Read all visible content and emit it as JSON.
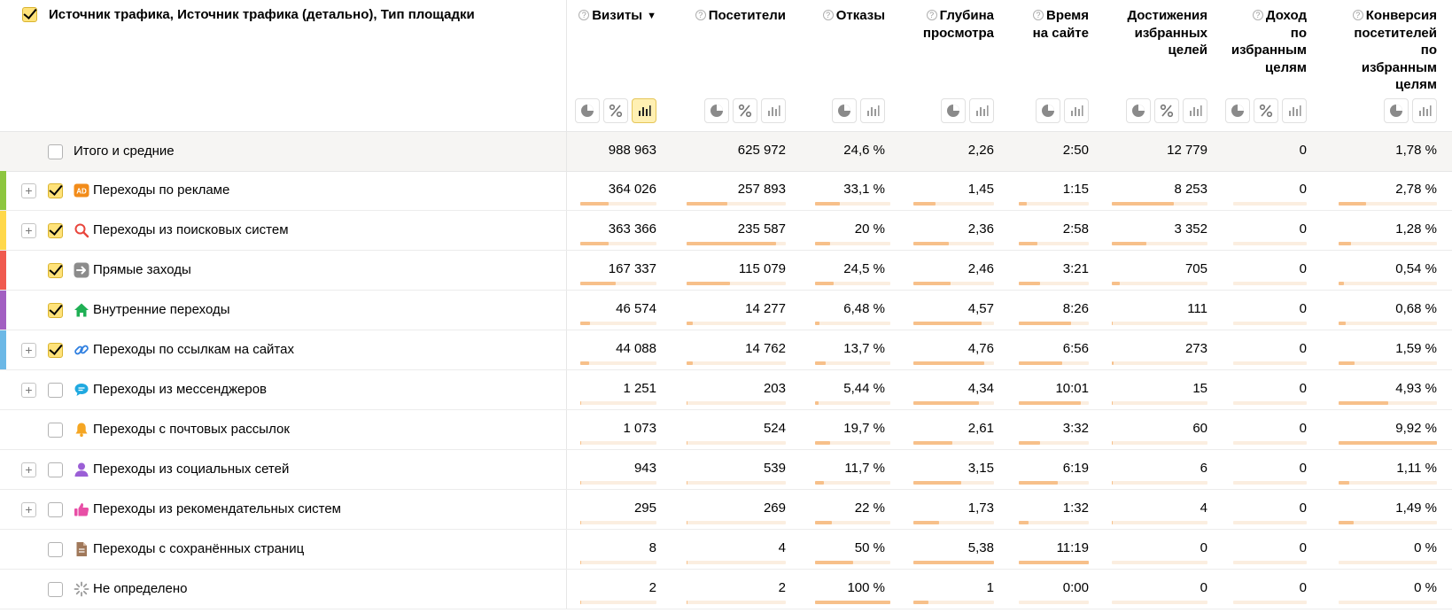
{
  "header": {
    "dimension_title": "Источник трафика, Источник трафика (детально), Тип площадки",
    "help_mark": "?",
    "sort_mark": "▼",
    "metrics": [
      {
        "title": "Визиты",
        "help": true,
        "sorted": true,
        "tools": [
          "pie",
          "percent",
          "bars-active"
        ]
      },
      {
        "title": "Посетители",
        "help": true,
        "sorted": false,
        "tools": [
          "pie",
          "percent",
          "bars"
        ]
      },
      {
        "title": "Отказы",
        "help": true,
        "sorted": false,
        "tools": [
          "pie",
          "bars"
        ]
      },
      {
        "title": "Глубина\nпросмотра",
        "help": true,
        "sorted": false,
        "tools": [
          "pie",
          "bars"
        ]
      },
      {
        "title": "Время\nна сайте",
        "help": true,
        "sorted": false,
        "tools": [
          "pie",
          "bars"
        ]
      },
      {
        "title": "Достижения\nизбранных\nцелей",
        "help": false,
        "sorted": false,
        "tools": [
          "pie",
          "percent",
          "bars"
        ]
      },
      {
        "title": "Доход\nпо\nизбранным\nцелям",
        "help": true,
        "sorted": false,
        "tools": [
          "pie",
          "percent",
          "bars"
        ]
      },
      {
        "title": "Конверсия\nпосетителей\nпо\nизбранным\nцелям",
        "help": true,
        "sorted": false,
        "tools": [
          "pie",
          "bars"
        ]
      }
    ]
  },
  "totals": {
    "label": "Итого и средние",
    "values": [
      "988 963",
      "625 972",
      "24,6 %",
      "2,26",
      "2:50",
      "12 779",
      "0",
      "1,78 %"
    ]
  },
  "rows": [
    {
      "label": "Переходы по рекламе",
      "icon": "ad-icon",
      "icon_text": "AD",
      "color": "#8dc63f",
      "expandable": true,
      "checked": true,
      "values": [
        "364 026",
        "257 893",
        "33,1 %",
        "1,45",
        "1:15",
        "8 253",
        "0",
        "2,78 %"
      ],
      "fills": [
        0.37,
        0.41,
        0.33,
        0.27,
        0.11,
        0.65,
        0,
        0.28
      ]
    },
    {
      "label": "Переходы из поисковых систем",
      "icon": "search-icon",
      "color": "#ffd84a",
      "expandable": true,
      "checked": true,
      "values": [
        "363 366",
        "235 587",
        "20 %",
        "2,36",
        "2:58",
        "3 352",
        "0",
        "1,28 %"
      ],
      "fills": [
        0.37,
        0.9,
        0.2,
        0.44,
        0.26,
        0.36,
        0,
        0.13
      ]
    },
    {
      "label": "Прямые заходы",
      "icon": "arrow-right-icon",
      "color": "#f05a4f",
      "expandable": false,
      "checked": true,
      "values": [
        "167 337",
        "115 079",
        "24,5 %",
        "2,46",
        "3:21",
        "705",
        "0",
        "0,54 %"
      ],
      "fills": [
        0.46,
        0.44,
        0.25,
        0.46,
        0.3,
        0.08,
        0,
        0.05
      ]
    },
    {
      "label": "Внутренние переходы",
      "icon": "home-icon",
      "color": "#a25fc2",
      "expandable": false,
      "checked": true,
      "values": [
        "46 574",
        "14 277",
        "6,48 %",
        "4,57",
        "8:26",
        "111",
        "0",
        "0,68 %"
      ],
      "fills": [
        0.13,
        0.06,
        0.06,
        0.85,
        0.75,
        0.01,
        0,
        0.07
      ]
    },
    {
      "label": "Переходы по ссылкам на сайтах",
      "icon": "link-icon",
      "color": "#6cb8e6",
      "expandable": true,
      "checked": true,
      "values": [
        "44 088",
        "14 762",
        "13,7 %",
        "4,76",
        "6:56",
        "273",
        "0",
        "1,59 %"
      ],
      "fills": [
        0.12,
        0.06,
        0.14,
        0.88,
        0.62,
        0.02,
        0,
        0.16
      ]
    },
    {
      "label": "Переходы из мессенджеров",
      "icon": "chat-icon",
      "color": "",
      "expandable": true,
      "checked": false,
      "values": [
        "1 251",
        "203",
        "5,44 %",
        "4,34",
        "10:01",
        "15",
        "0",
        "4,93 %"
      ],
      "fills": [
        0.01,
        0.01,
        0.05,
        0.81,
        0.89,
        0.01,
        0,
        0.5
      ]
    },
    {
      "label": "Переходы с почтовых рассылок",
      "icon": "bell-icon",
      "color": "",
      "expandable": false,
      "checked": false,
      "values": [
        "1 073",
        "524",
        "19,7 %",
        "2,61",
        "3:32",
        "60",
        "0",
        "9,92 %"
      ],
      "fills": [
        0.01,
        0.01,
        0.2,
        0.48,
        0.31,
        0.01,
        0,
        1
      ]
    },
    {
      "label": "Переходы из социальных сетей",
      "icon": "person-icon",
      "color": "",
      "expandable": true,
      "checked": false,
      "values": [
        "943",
        "539",
        "11,7 %",
        "3,15",
        "6:19",
        "6",
        "0",
        "1,11 %"
      ],
      "fills": [
        0.01,
        0.01,
        0.12,
        0.59,
        0.56,
        0.01,
        0,
        0.11
      ]
    },
    {
      "label": "Переходы из рекомендательных систем",
      "icon": "thumbs-up-icon",
      "color": "",
      "expandable": true,
      "checked": false,
      "values": [
        "295",
        "269",
        "22 %",
        "1,73",
        "1:32",
        "4",
        "0",
        "1,49 %"
      ],
      "fills": [
        0.01,
        0.01,
        0.22,
        0.32,
        0.14,
        0.01,
        0,
        0.15
      ]
    },
    {
      "label": "Переходы с сохранённых страниц",
      "icon": "document-icon",
      "color": "",
      "expandable": false,
      "checked": false,
      "values": [
        "8",
        "4",
        "50 %",
        "5,38",
        "11:19",
        "0",
        "0",
        "0 %"
      ],
      "fills": [
        0.01,
        0.01,
        0.5,
        1,
        1,
        0,
        0,
        0
      ]
    },
    {
      "label": "Не определено",
      "icon": "spinner-icon",
      "color": "",
      "expandable": false,
      "checked": false,
      "values": [
        "2",
        "2",
        "100 %",
        "1",
        "0:00",
        "0",
        "0",
        "0 %"
      ],
      "fills": [
        0.01,
        0.01,
        1,
        0.19,
        0,
        0,
        0,
        0
      ]
    }
  ],
  "colors": {
    "bar_fill": "#f7c08a",
    "bar_track": "#fbeee0",
    "checkbox_on": "#ffe27a",
    "total_bg": "#f6f5f3"
  }
}
